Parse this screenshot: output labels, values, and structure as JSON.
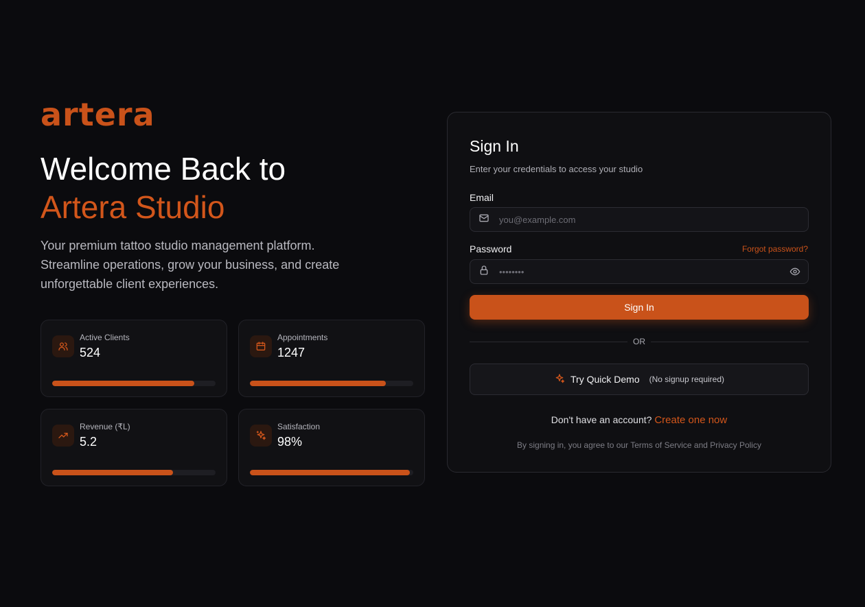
{
  "brand": {
    "logo": "artera",
    "accent_color": "#c9521a"
  },
  "hero": {
    "title_line1": "Welcome Back to",
    "title_line2": "Artera Studio",
    "tagline": "Your premium tattoo studio management platform. Streamline operations, grow your business, and create unforgettable client experiences."
  },
  "stats": [
    {
      "icon": "users-icon",
      "label": "Active Clients",
      "value": "524",
      "progress": 0.87
    },
    {
      "icon": "calendar-icon",
      "label": "Appointments",
      "value": "1247",
      "progress": 0.83
    },
    {
      "icon": "trending-up-icon",
      "label": "Revenue (₹L)",
      "value": "5.2",
      "progress": 0.74
    },
    {
      "icon": "sparkles-icon",
      "label": "Satisfaction",
      "value": "98%",
      "progress": 0.98
    }
  ],
  "signin": {
    "title": "Sign In",
    "subtitle": "Enter your credentials to access your studio",
    "email_label": "Email",
    "email_placeholder": "you@example.com",
    "password_label": "Password",
    "password_placeholder": "••••••••",
    "forgot_label": "Forgot password?",
    "submit_label": "Sign In",
    "divider_label": "OR",
    "demo_label": "Try Quick Demo",
    "demo_note": "(No signup required)",
    "account_prompt": "Don't have an account?",
    "account_link": "Create one now",
    "terms": "By signing in, you agree to our Terms of Service and Privacy Policy"
  }
}
